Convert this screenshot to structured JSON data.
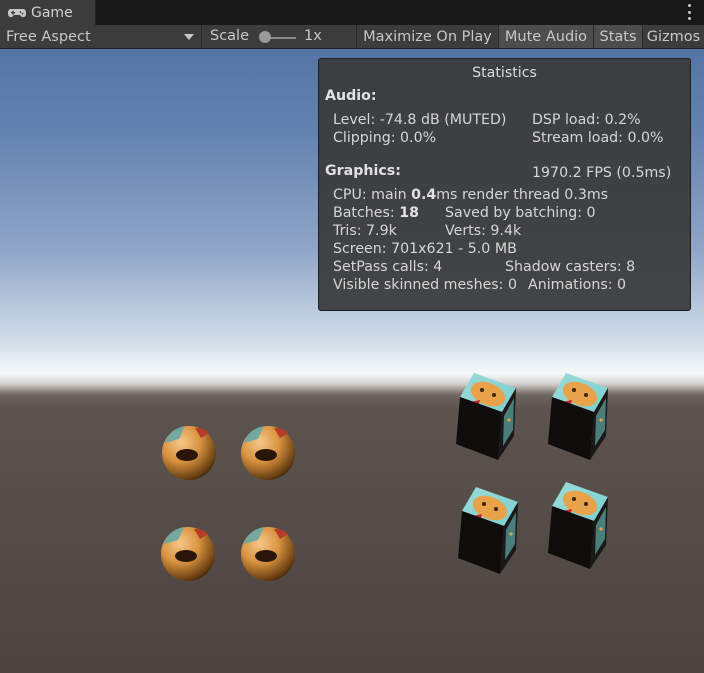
{
  "tab": {
    "title": "Game",
    "icon": "gamepad-icon"
  },
  "menu_icon": "kebab-menu-icon",
  "toolbar": {
    "aspect": "Free Aspect",
    "scale_label": "Scale",
    "scale_value": "1x",
    "maximize_label": "Maximize On Play",
    "mute_label": "Mute Audio",
    "stats_label": "Stats",
    "gizmos_label": "Gizmos"
  },
  "stats": {
    "title": "Statistics",
    "audio_heading": "Audio:",
    "level": "Level: -74.8 dB (MUTED)",
    "dsp": "DSP load: 0.2%",
    "clipping": "Clipping: 0.0%",
    "stream": "Stream load: 0.0%",
    "graphics_heading": "Graphics:",
    "fps": "1970.2 FPS (0.5ms)",
    "cpu_prefix": "CPU: main ",
    "cpu_main": "0.4",
    "cpu_suffix": "ms  render thread 0.3ms",
    "batches_prefix": "Batches: ",
    "batches": "18",
    "saved": "Saved by batching: 0",
    "tris": "Tris: 7.9k",
    "verts": "Verts: 9.4k",
    "screen": "Screen: 701x621 - 5.0 MB",
    "setpass": "SetPass calls: 4",
    "shadow": "Shadow casters: 8",
    "skinned": "Visible skinned meshes: 0",
    "animations": "Animations: 0"
  },
  "colors": {
    "toolbar_bg": "#3c3c3c",
    "active_button_bg": "#4d4d4d",
    "panel_bg": "#3a3a3a",
    "sky_top": "#5474a3",
    "ground": "#5c534e",
    "texture_cyan": "#7ccfd0",
    "texture_orange": "#e8a24a"
  }
}
